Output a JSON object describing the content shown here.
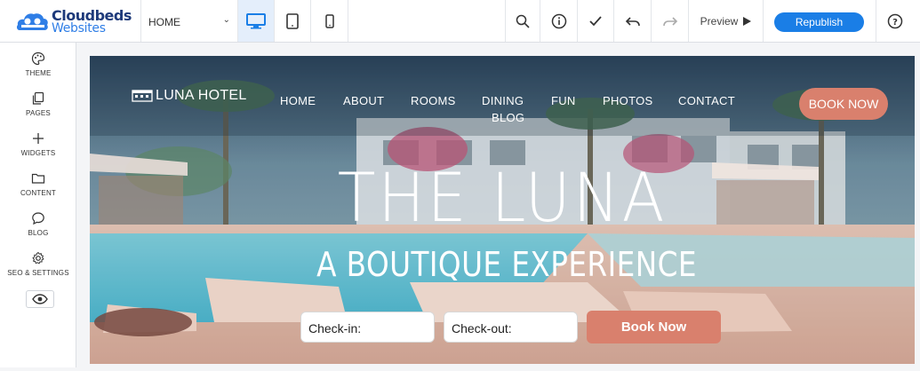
{
  "toolbar": {
    "logo_line1": "Cloudbeds",
    "logo_line2": "Websites",
    "page_select": "HOME",
    "preview_label": "Preview",
    "republish_label": "Republish"
  },
  "sidebar": {
    "items": [
      {
        "label": "THEME",
        "icon": "palette-icon"
      },
      {
        "label": "PAGES",
        "icon": "pages-icon"
      },
      {
        "label": "WIDGETS",
        "icon": "plus-icon"
      },
      {
        "label": "CONTENT",
        "icon": "folder-icon"
      },
      {
        "label": "BLOG",
        "icon": "chat-bubble-icon"
      },
      {
        "label": "SEO & SETTINGS",
        "icon": "gear-icon"
      }
    ]
  },
  "site": {
    "brand": "LUNA HOTEL",
    "nav": [
      "HOME",
      "ABOUT",
      "ROOMS",
      "DINING",
      "FUN",
      "PHOTOS",
      "CONTACT",
      "BLOG"
    ],
    "book_now_top": "BOOK NOW",
    "hero_title": "THE LUNA",
    "hero_subtitle": "A BOUTIQUE EXPERIENCE",
    "checkin_label": "Check-in:",
    "checkout_label": "Check-out:",
    "book_button": "Book Now"
  },
  "colors": {
    "accent": "#1a7ee6",
    "brand_dark": "#1e3a7a",
    "cta": "#d9806d"
  }
}
